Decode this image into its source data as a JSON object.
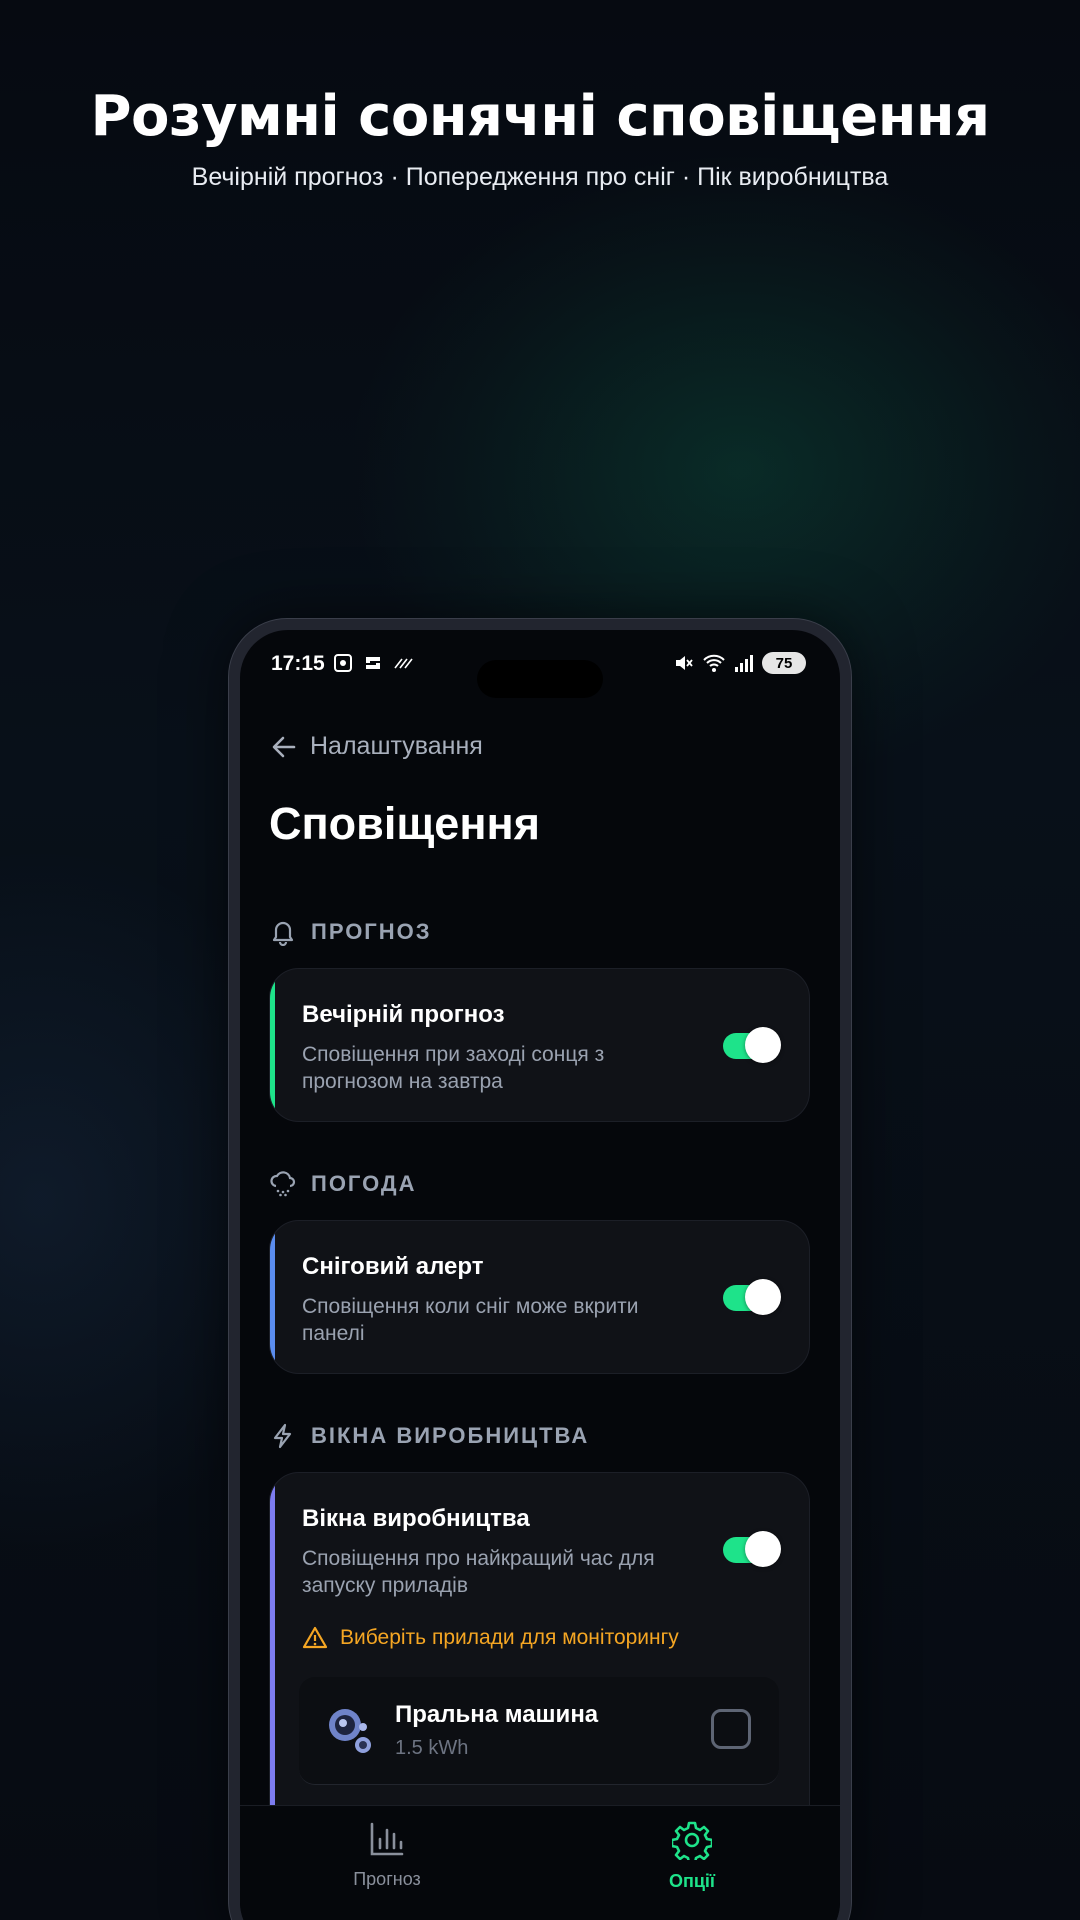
{
  "promo": {
    "headline": "Розумні сонячні сповіщення",
    "subline": "Вечірній прогноз · Попередження про сніг · Пік виробництва"
  },
  "status_bar": {
    "time": "17:15",
    "battery": "75"
  },
  "header": {
    "back_label": "Налаштування",
    "title": "Сповіщення"
  },
  "sections": [
    {
      "label": "ПРОГНОЗ",
      "icon": "bell-icon",
      "accent": "#1ee38a",
      "card": {
        "title": "Вечірній прогноз",
        "description": "Сповіщення при заході сонця з прогнозом на завтра",
        "enabled": true
      }
    },
    {
      "label": "ПОГОДА",
      "icon": "snow-cloud-icon",
      "accent": "#5b8def",
      "card": {
        "title": "Сніговий алерт",
        "description": "Сповіщення коли сніг може вкрити панелі",
        "enabled": true
      }
    },
    {
      "label": "ВІКНА ВИРОБНИЦТВА",
      "icon": "lightning-icon",
      "accent": "#7d7cf0",
      "card": {
        "title": "Вікна виробництва",
        "description": "Сповіщення про найкращий час для запуску приладів",
        "enabled": true,
        "warning": "Виберіть прилади для моніторингу",
        "devices": [
          {
            "name": "Пральна машина",
            "energy": "1.5 kWh",
            "icon": "washing-machine-icon",
            "checked": false
          }
        ]
      }
    }
  ],
  "bottom_nav": {
    "items": [
      {
        "label": "Прогноз",
        "icon": "bar-chart-icon",
        "active": false
      },
      {
        "label": "Опції",
        "icon": "gear-icon",
        "active": true
      }
    ],
    "active_color": "#1ee38a",
    "inactive_color": "#8a909c"
  }
}
